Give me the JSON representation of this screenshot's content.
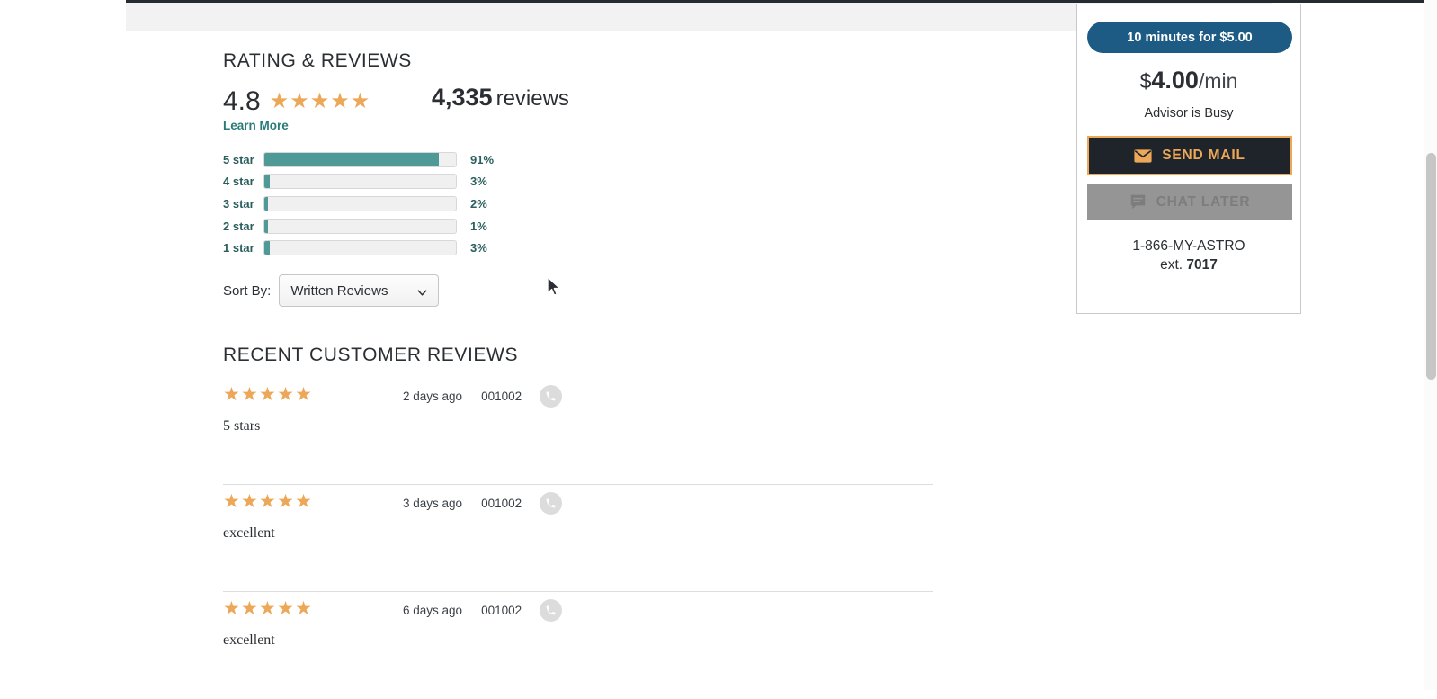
{
  "page": {
    "rating_section_title": "RATING & REVIEWS",
    "recent_section_title": "RECENT CUSTOMER REVIEWS"
  },
  "summary": {
    "score": "4.8",
    "stars": "★★★★★",
    "review_count": "4,335",
    "review_count_word": "reviews",
    "learn_more": "Learn More"
  },
  "distribution": {
    "rows": [
      {
        "label": "5 star",
        "percent": "91%",
        "value": 91
      },
      {
        "label": "4 star",
        "percent": "3%",
        "value": 3
      },
      {
        "label": "3 star",
        "percent": "2%",
        "value": 2
      },
      {
        "label": "2 star",
        "percent": "1%",
        "value": 1
      },
      {
        "label": "1 star",
        "percent": "3%",
        "value": 3
      }
    ]
  },
  "sort": {
    "label": "Sort By:",
    "selected": "Written Reviews",
    "options": [
      "Written Reviews"
    ]
  },
  "reviews": [
    {
      "stars": "★★★★★",
      "ago": "2 days ago",
      "id": "001002",
      "body": "5 stars",
      "icon": "phone-icon"
    },
    {
      "stars": "★★★★★",
      "ago": "3 days ago",
      "id": "001002",
      "body": "excellent",
      "icon": "phone-icon"
    },
    {
      "stars": "★★★★★",
      "ago": "6 days ago",
      "id": "001002",
      "body": "excellent",
      "icon": "phone-icon"
    }
  ],
  "promo": {
    "cta_label": "10 minutes for $5.00",
    "price_currency": "$",
    "price_amount": "4.00",
    "price_per": "/min",
    "status": "Advisor is Busy",
    "send_mail_label": "SEND MAIL",
    "send_mail_icon": "envelope-icon",
    "chat_later_label": "CHAT LATER",
    "chat_later_icon": "chat-bubble-icon",
    "phone": "1-866-MY-ASTRO",
    "ext_label": "ext.",
    "ext_number": "7017"
  },
  "colors": {
    "teal": "#4f9a96",
    "teal_text": "#2a5f5d",
    "star_orange": "#eca858",
    "promo_blue": "#1d5b85",
    "dark": "#1f242b",
    "chat_gray": "#959595"
  },
  "chart_data": {
    "type": "bar",
    "title": "RATING & REVIEWS",
    "categories": [
      "5 star",
      "4 star",
      "3 star",
      "2 star",
      "1 star"
    ],
    "values": [
      91,
      3,
      2,
      1,
      3
    ],
    "xlabel": "",
    "ylabel": "",
    "ylim": [
      0,
      100
    ],
    "orientation": "horizontal",
    "grid": false,
    "legend": "none",
    "annotations": [
      "4.8 average",
      "4,335 reviews"
    ]
  }
}
